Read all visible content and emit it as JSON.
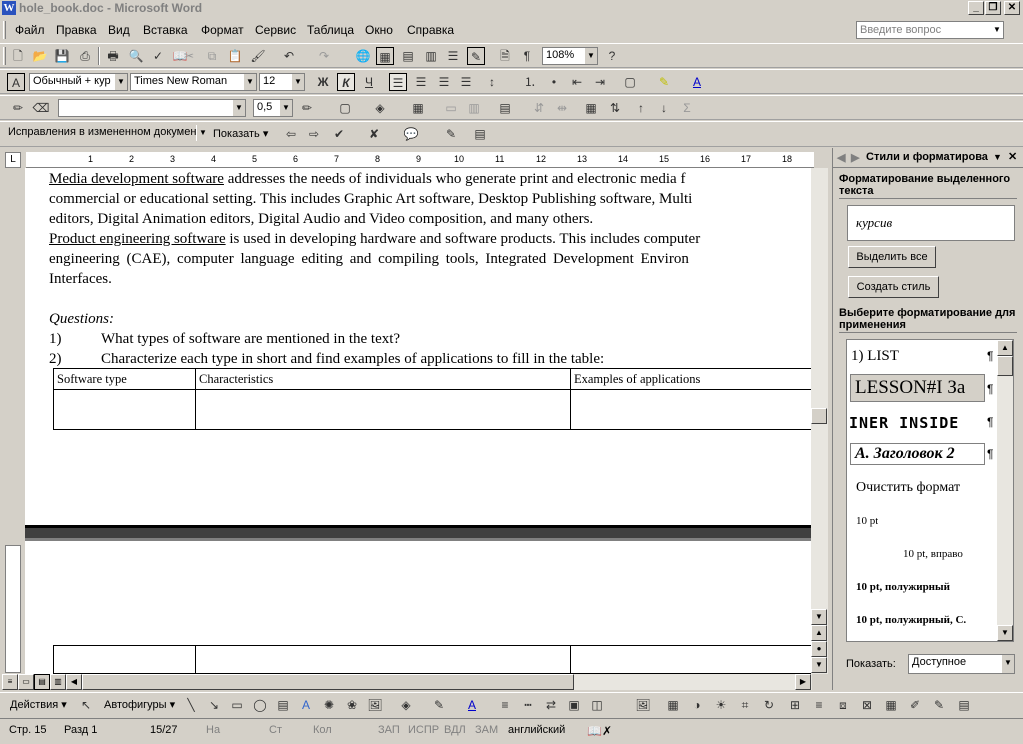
{
  "window": {
    "title": "hole_book.doc - Microsoft Word",
    "min": "_",
    "max": "❐",
    "close": "✕"
  },
  "menu": [
    "Файл",
    "Правка",
    "Вид",
    "Вставка",
    "Формат",
    "Сервис",
    "Таблица",
    "Окно",
    "Справка"
  ],
  "help": {
    "placeholder": "Введите вопрос"
  },
  "standard": {
    "zoom": "108%"
  },
  "formatting": {
    "style": "Обычный + кур",
    "font": "Times New Roman",
    "size": "12",
    "bold": "Ж",
    "italic": "К",
    "underline": "Ч"
  },
  "drawing_tb": {
    "linewidth": "0,5"
  },
  "reviewing": {
    "mode": "Исправления в измененном документе",
    "show": "Показать"
  },
  "ruler": {
    "ticks": [
      "1",
      "2",
      "3",
      "4",
      "5",
      "6",
      "7",
      "8",
      "9",
      "10",
      "11",
      "12",
      "13",
      "14",
      "15",
      "16",
      "17",
      "18"
    ]
  },
  "document": {
    "p1": {
      "link": "Media development software",
      "l1": "addresses the needs of individuals who generate print and electronic media f",
      "l2": "commercial or educational setting. This includes Graphic Art software, Desktop Publishing software, Multi",
      "l3": "editors, Digital Animation editors, Digital Audio and Video composition, and many others."
    },
    "p2": {
      "link": "Product engineering software",
      "l1": "is used in developing hardware and software products. This includes computer",
      "l2": "engineering (CAE), computer language editing and compiling tools, Integrated Development Environ",
      "l3": "Interfaces."
    },
    "questions": "Questions:",
    "q1": {
      "num": "1)",
      "text": "What types of software are mentioned in the text?"
    },
    "q2": {
      "num": "2)",
      "text": "Characterize each type in short and find examples of applications to fill in the table:"
    },
    "table": {
      "headers": [
        "Software type",
        "Characteristics",
        "Examples of applications"
      ]
    }
  },
  "taskpane": {
    "title": "Стили и форматирова",
    "selected_label": "Форматирование выделенного текста",
    "current": "курсив",
    "select_all": "Выделить все",
    "new_style": "Создать стиль",
    "apply_label": "Выберите форматирование для применения",
    "styles": [
      "1) LIST",
      "LESSON#I За",
      "INER INSIDE",
      "A. Заголовок 2",
      "Очистить формат",
      "10 pt",
      "10 pt, вправо",
      "10 pt, полужирный",
      "10 pt, полужирный, С."
    ],
    "show_label": "Показать:",
    "show_value": "Доступное"
  },
  "drawbar": {
    "actions": "Действия",
    "autoshapes": "Автофигуры"
  },
  "status": {
    "page": "Стр. 15",
    "section": "Разд 1",
    "pages": "15/27",
    "at": "На",
    "line": "Ст",
    "col": "Кол",
    "rec": "ЗАП",
    "trk": "ИСПР",
    "ext": "ВДЛ",
    "ovr": "ЗАМ",
    "lang": "английский"
  }
}
